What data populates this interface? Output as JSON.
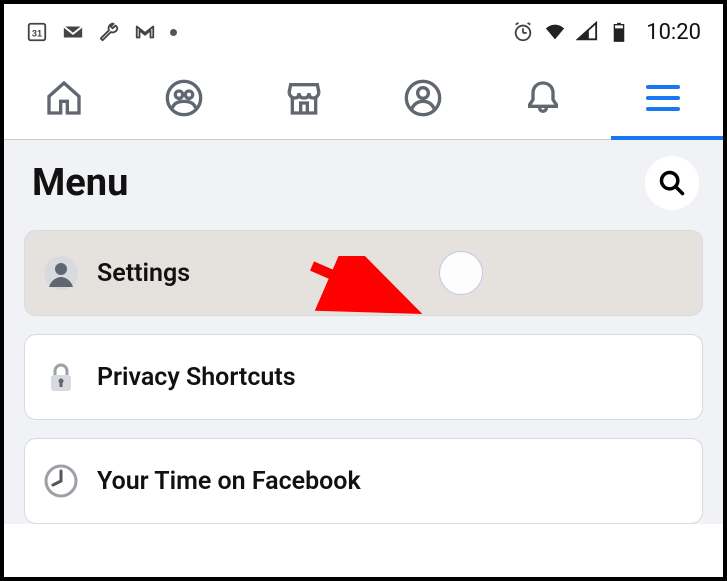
{
  "status_bar": {
    "calendar_day": "31",
    "time": "10:20"
  },
  "page": {
    "title": "Menu"
  },
  "menu_items": [
    {
      "label": "Settings"
    },
    {
      "label": "Privacy Shortcuts"
    },
    {
      "label": "Your Time on Facebook"
    }
  ]
}
